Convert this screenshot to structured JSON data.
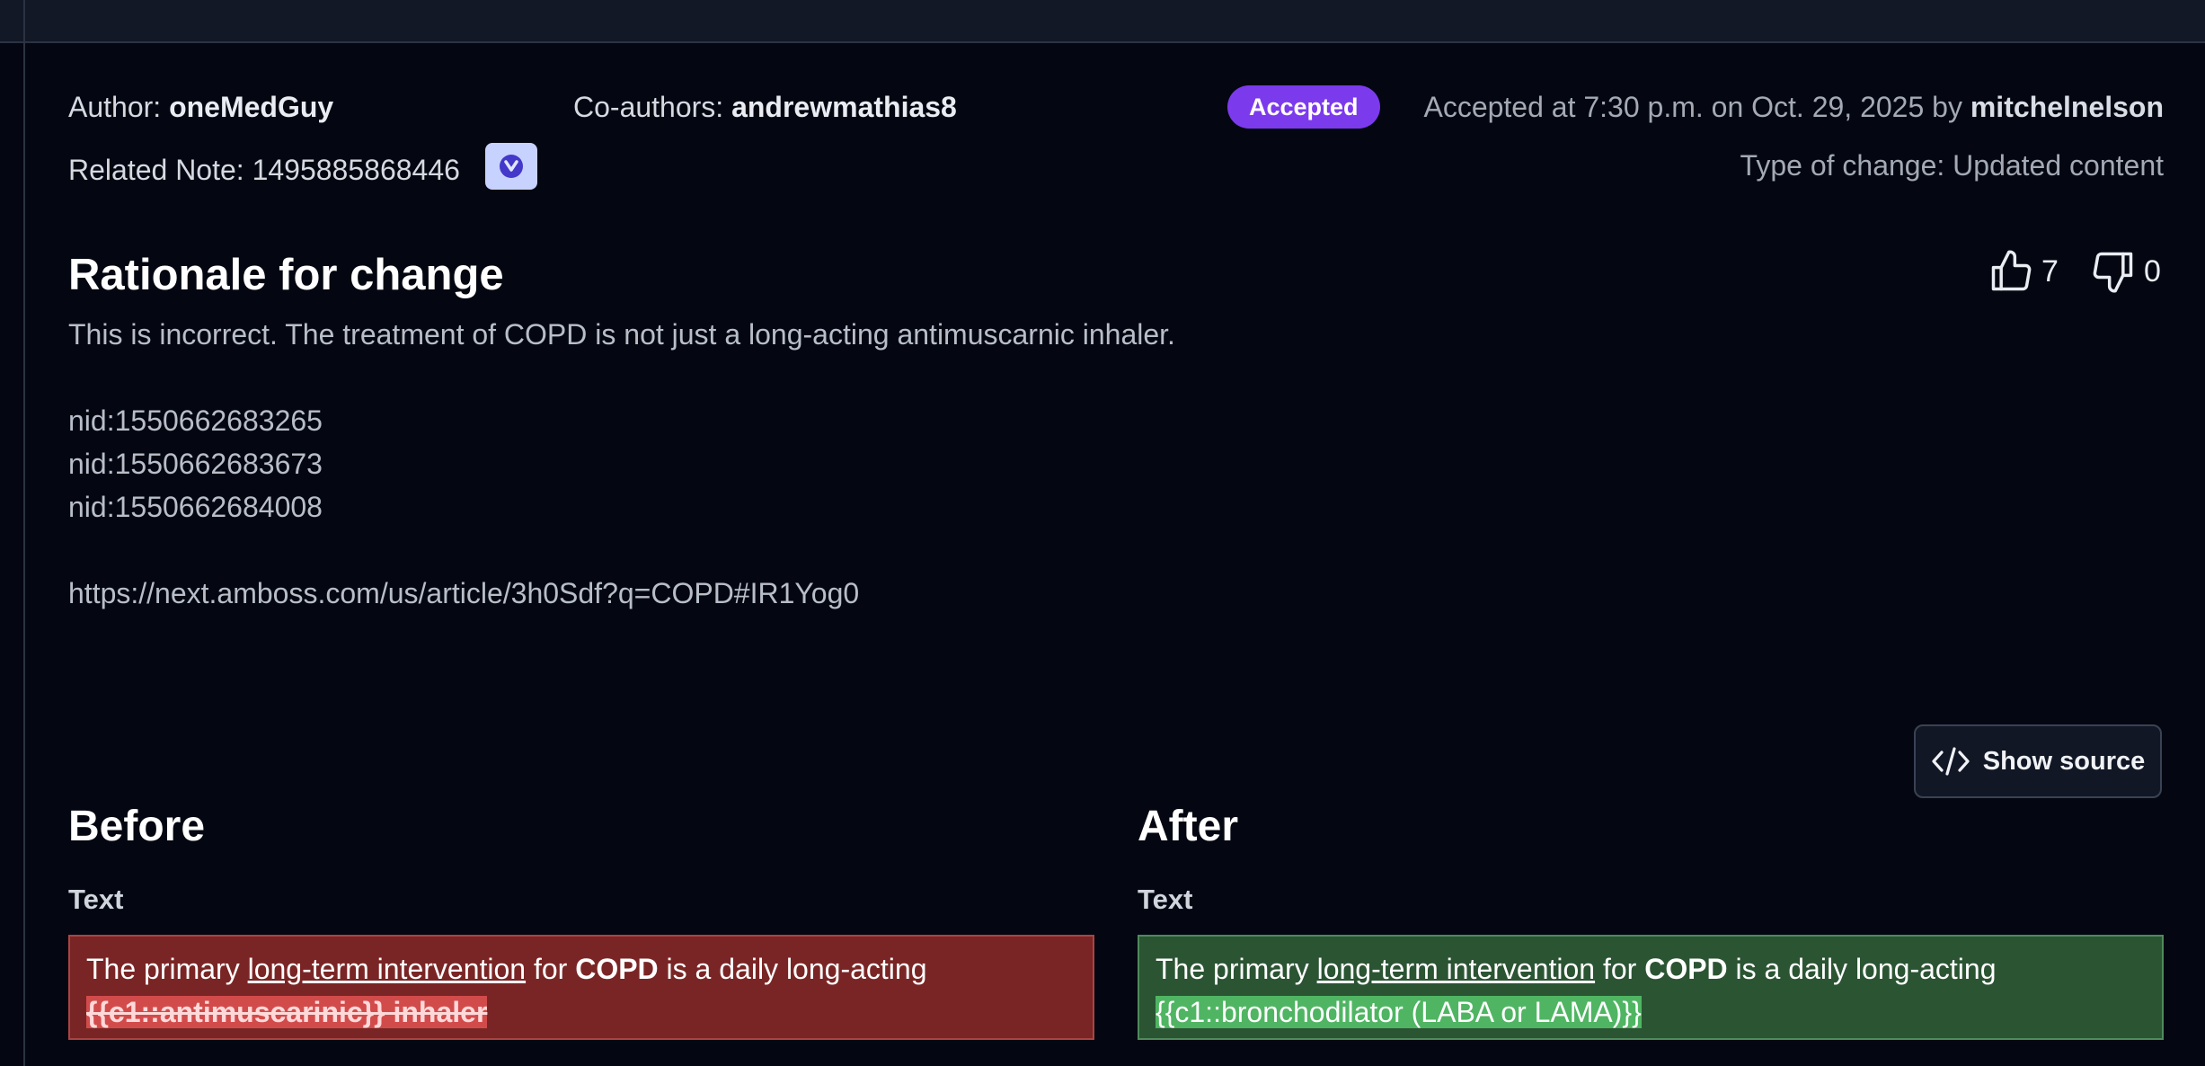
{
  "header": {
    "author_label": "Author:",
    "author": "oneMedGuy",
    "coauthors_label": "Co-authors:",
    "coauthors": "andrewmathias8",
    "status": "Accepted",
    "accepted_text": "Accepted at 7:30 p.m. on Oct. 29, 2025 by",
    "accepted_by": "mitchelnelson",
    "related_note_label": "Related Note:",
    "related_note_id": "1495885868446",
    "change_type": "Type of change: Updated content"
  },
  "rationale": {
    "title": "Rationale for change",
    "lines": [
      "This is incorrect. The treatment of COPD is not just a long-acting antimuscarnic inhaler.",
      "",
      "nid:1550662683265",
      "nid:1550662683673",
      "nid:1550662684008",
      "",
      "https://next.amboss.com/us/article/3h0Sdf?q=COPD#IR1Yog0"
    ]
  },
  "votes": {
    "up": "7",
    "down": "0"
  },
  "show_source_label": "Show source",
  "before": {
    "heading": "Before",
    "field": "Text",
    "t1": "The primary ",
    "t2": "long-term intervention",
    "t3": " for ",
    "t4": "COPD",
    "t5": " is a daily long-acting",
    "removed": "{{c1::antimuscarinic}} inhaler"
  },
  "after": {
    "heading": "After",
    "field": "Text",
    "t1": "The primary ",
    "t2": "long-term intervention",
    "t3": " for ",
    "t4": "COPD",
    "t5": " is a daily long-acting",
    "added": "{{c1::bronchodilator (LABA or LAMA)}}"
  },
  "colors": {
    "status_badge": "#7c3aed",
    "removed_bg": "#7a2525",
    "added_bg": "#2b5433"
  }
}
